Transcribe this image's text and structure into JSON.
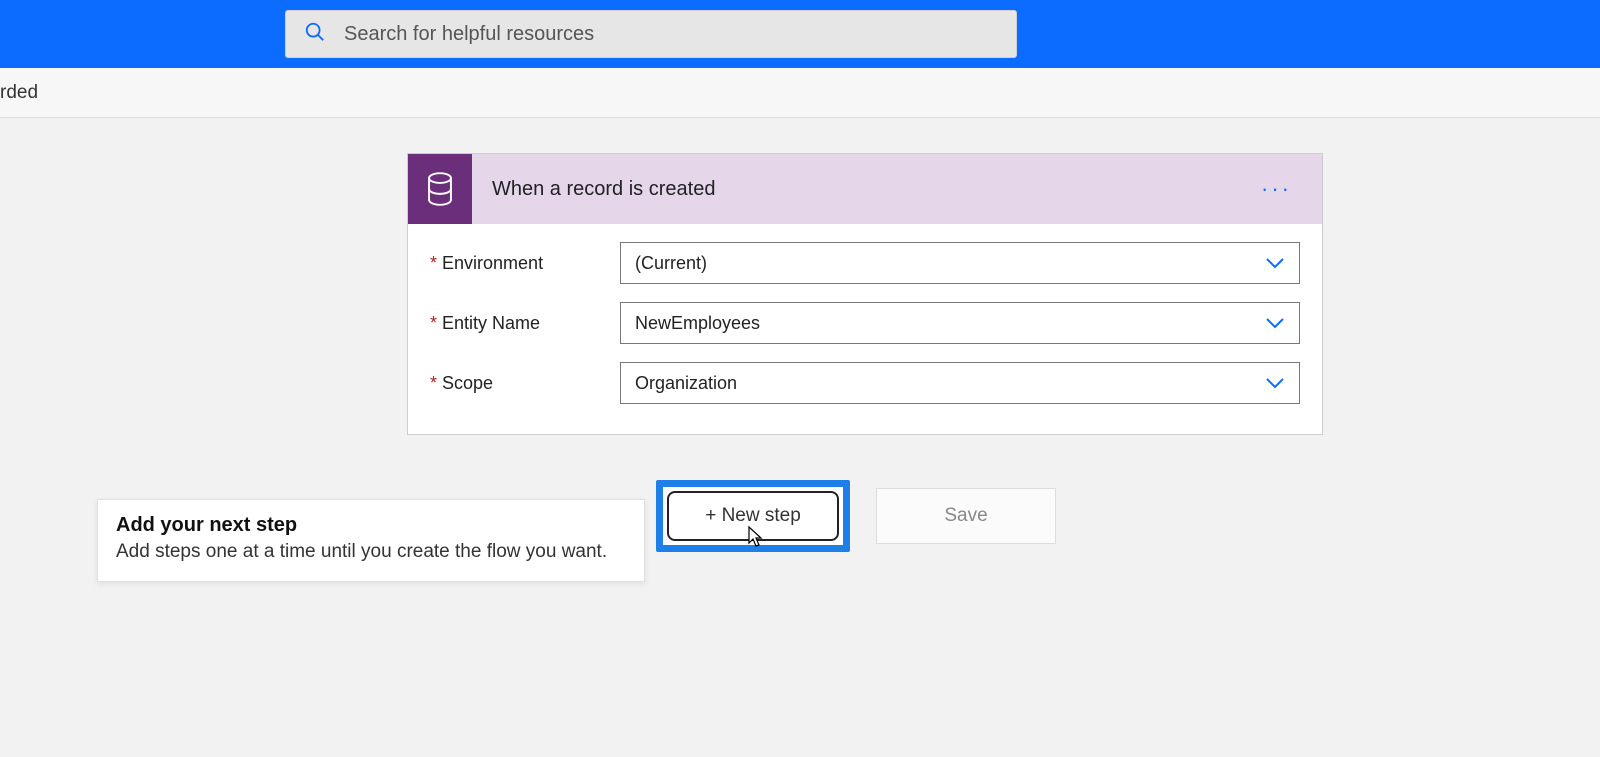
{
  "header": {
    "search_placeholder": "Search for helpful resources"
  },
  "subheader": {
    "fragment": "rded"
  },
  "trigger": {
    "title": "When a record is created",
    "icon_name": "database-icon",
    "fields": [
      {
        "label": "Environment",
        "value": "(Current)"
      },
      {
        "label": "Entity Name",
        "value": "NewEmployees"
      },
      {
        "label": "Scope",
        "value": "Organization"
      }
    ]
  },
  "tooltip": {
    "title": "Add your next step",
    "body": "Add steps one at a time until you create the flow you want."
  },
  "buttons": {
    "new_step": "+ New step",
    "save": "Save"
  },
  "colors": {
    "brand_blue": "#0b6cff",
    "trigger_purple": "#6b2e7a",
    "trigger_header_bg": "#e5d6ea",
    "highlight_blue": "#1f7fe8"
  }
}
